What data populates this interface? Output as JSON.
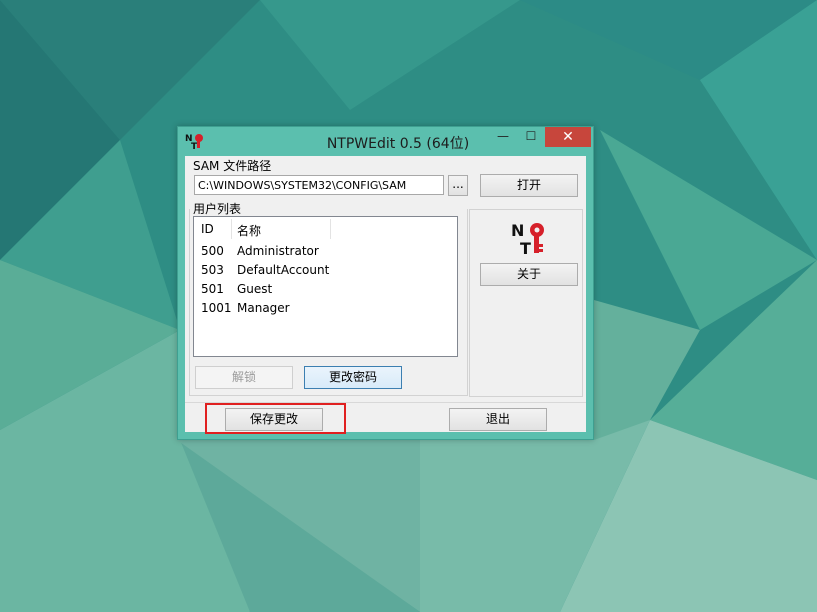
{
  "window": {
    "title": "NTPWEdit 0.5 (64位)",
    "minimize_glyph": "—",
    "maximize_glyph": "☐",
    "close_glyph": "✕"
  },
  "sam": {
    "label": "SAM 文件路径",
    "path": "C:\\WINDOWS\\SYSTEM32\\CONFIG\\SAM",
    "browse_label": "...",
    "open_label": "打开"
  },
  "users": {
    "label": "用户列表",
    "columns": [
      "ID",
      "名称"
    ],
    "rows": [
      {
        "id": "500",
        "name": "Administrator"
      },
      {
        "id": "503",
        "name": "DefaultAccount"
      },
      {
        "id": "501",
        "name": "Guest"
      },
      {
        "id": "1001",
        "name": "Manager"
      }
    ],
    "unlock_label": "解锁",
    "change_password_label": "更改密码"
  },
  "about_label": "关于",
  "save_label": "保存更改",
  "exit_label": "退出",
  "icons": {
    "app": "ntpwedit-key-icon",
    "logo": "nt-key-logo-icon"
  },
  "colors": {
    "titlebar": "#5bbfae",
    "close": "#c7463c",
    "highlight": "#e02020",
    "key_red": "#d6202a"
  }
}
